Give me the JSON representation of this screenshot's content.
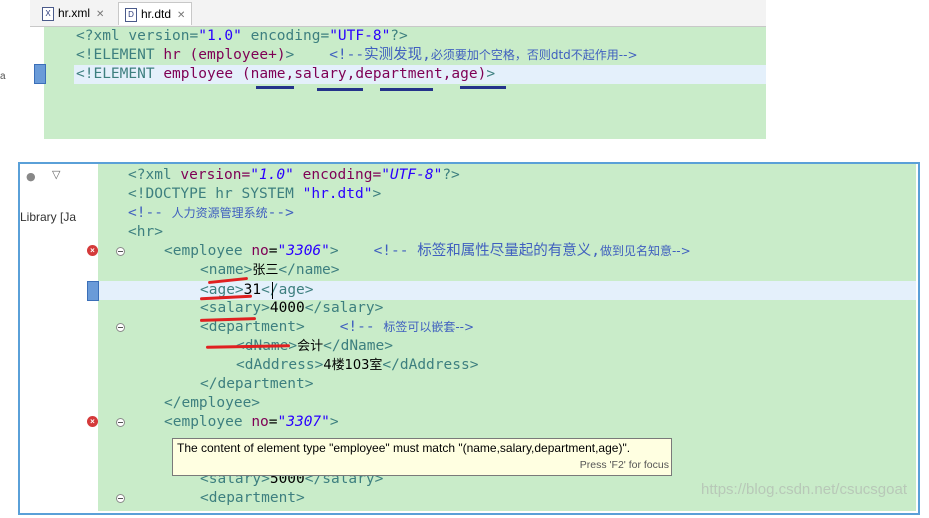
{
  "top_panel": {
    "side_label": "a",
    "tabs": [
      {
        "label": "hr.xml",
        "icon": "X"
      },
      {
        "label": "hr.dtd",
        "icon": "D"
      }
    ],
    "lines": {
      "l1": {
        "a": "<?xml version=",
        "b": "\"1.0\"",
        "c": " encoding=",
        "d": "\"UTF-8\"",
        "e": "?>"
      },
      "l2": {
        "a": "<!ELEMENT ",
        "b": "hr ",
        "c": "(employee+)",
        "d": ">    ",
        "e": "<!--实测发现,",
        "f": "必须要加个空格，否则dtd不起作用-->"
      },
      "l3": {
        "a": "<!ELEMENT ",
        "b": "employee ",
        "c": "(name,salary,department,age)",
        "d": ">"
      }
    }
  },
  "bottom_panel": {
    "library_label": "Library [Ja",
    "lines": {
      "l1": {
        "a": "<?xml ",
        "b": "version=",
        "c": "\"1.0\"",
        "d": " encoding=",
        "e": "\"UTF-8\"",
        "f": "?>"
      },
      "l2": {
        "a": "<!DOCTYPE hr SYSTEM ",
        "b": "\"hr.dtd\"",
        "c": ">"
      },
      "l3": {
        "a": "<!-- ",
        "b": "人力资源管理系统",
        "c": "-->"
      },
      "l4": {
        "a": "<hr>"
      },
      "l5": {
        "a": "<employee ",
        "b": "no",
        "c": "=",
        "d": "\"3306\"",
        "e": ">",
        "f": "<!-- 标签和属性尽量起的有意义,",
        "g": "做到见名知意-->"
      },
      "l6": {
        "a": "<name>",
        "b": "张三",
        "c": "</name>"
      },
      "l7": {
        "a": "<age>",
        "b": "31",
        "c": "</age>"
      },
      "l8": {
        "a": "<salary>",
        "b": "4000",
        "c": "</salary>"
      },
      "l9": {
        "a": "<department>",
        "b": "<!-- ",
        "c": "标签可以嵌套-->"
      },
      "l10": {
        "a": "<dName>",
        "b": "会计",
        "c": "</dName>"
      },
      "l11": {
        "a": "<dAddress>",
        "b": "4楼103室",
        "c": "</dAddress>"
      },
      "l12": {
        "a": "</department>"
      },
      "l13": {
        "a": "</employee>"
      },
      "l14": {
        "a": "<employee ",
        "b": "no",
        "c": "=",
        "d": "\"3307\"",
        "e": ">"
      },
      "l15": {
        "a": "<salary>",
        "b": "5000",
        "c": "</salary>"
      },
      "l16": {
        "a": "<department>"
      }
    },
    "tooltip": {
      "message": "The content of element type \"employee\" must match \"(name,salary,department,age)\".",
      "hint": "Press 'F2' for focus"
    },
    "watermark": "https://blog.csdn.net/csucsgoat"
  },
  "colors": {
    "editor_bg": "#c9ecc9",
    "current_line": "#e4f0fb",
    "tag": "#3d7f7f",
    "string": "#2a00ff",
    "comment": "#3f5fbf",
    "error": "#d43a3a",
    "annotation_red": "#e02020",
    "annotation_blue": "#24338a",
    "frame_border": "#5aa0d8"
  }
}
